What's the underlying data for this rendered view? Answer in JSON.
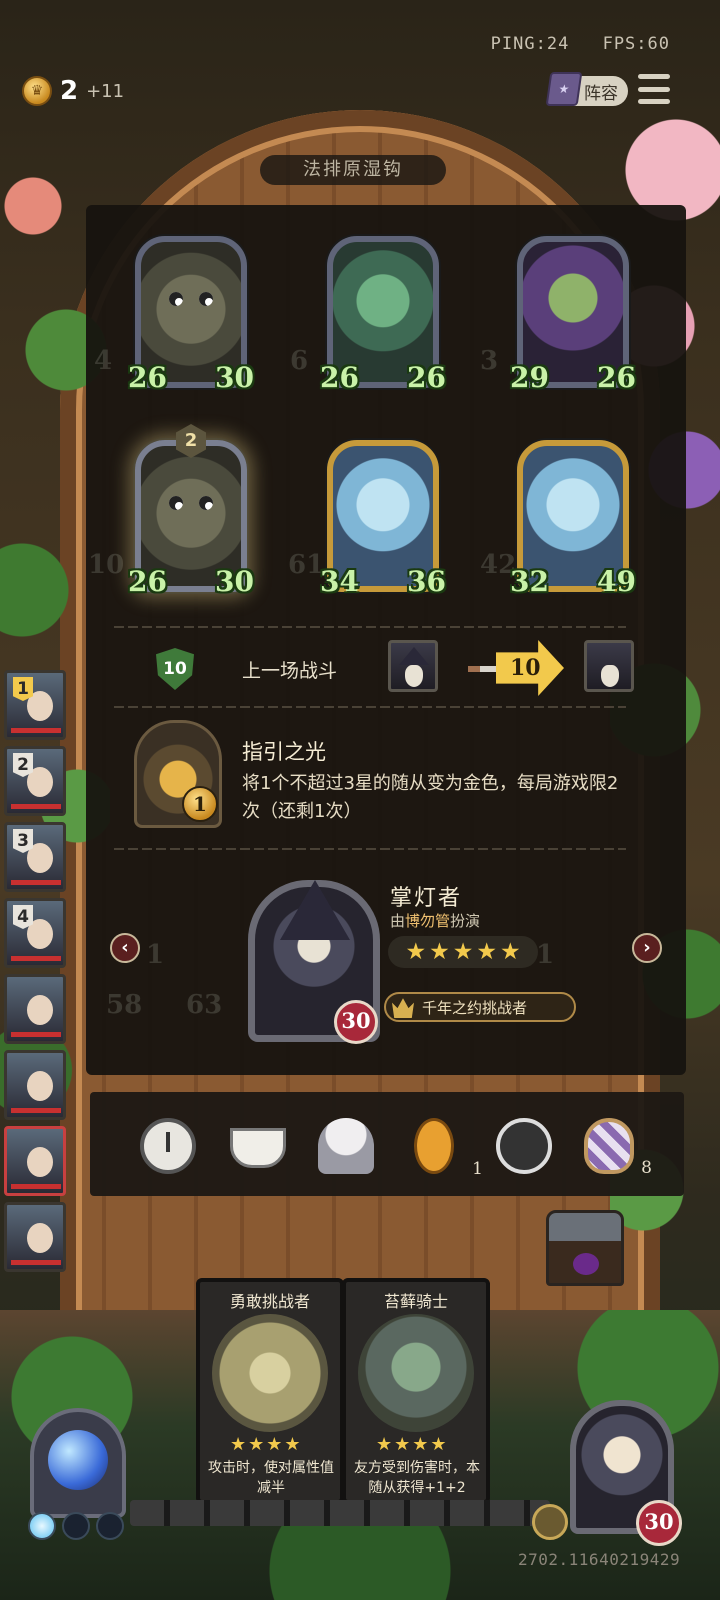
{
  "status": {
    "ping": "PING:24",
    "fps": "FPS:60"
  },
  "gold": {
    "count": "2",
    "income": "+11"
  },
  "header": {
    "lineup_label": "阵容"
  },
  "panel": {
    "title": "法排原湿钩",
    "board": [
      {
        "kind": "golem",
        "atk": "26",
        "hp": "30"
      },
      {
        "kind": "flower",
        "atk": "26",
        "hp": "26"
      },
      {
        "kind": "witch",
        "atk": "29",
        "hp": "26"
      },
      {
        "kind": "golem",
        "atk": "26",
        "hp": "30",
        "level": "2"
      },
      {
        "kind": "gold",
        "atk": "34",
        "hp": "36"
      },
      {
        "kind": "gold",
        "atk": "32",
        "hp": "49"
      }
    ],
    "last_battle": {
      "shield_value": "10",
      "label": "上一场战斗",
      "damage": "10"
    },
    "hero_power": {
      "name": "指引之光",
      "cost": "1",
      "description": "将1个不超过3星的随从变为金色，每局游戏限2次（还剩1次）"
    },
    "hero": {
      "name": "掌灯者",
      "by_prefix": "由",
      "actor": "博勿管",
      "by_suffix": "扮演",
      "stars": 5,
      "title": "千年之约挑战者",
      "hp": "30"
    }
  },
  "players": [
    {
      "rank": "1",
      "active": false
    },
    {
      "rank": "2",
      "active": false
    },
    {
      "rank": "3",
      "active": false
    },
    {
      "rank": "4",
      "active": false
    },
    {
      "rank": "",
      "active": false
    },
    {
      "rank": "",
      "active": false
    },
    {
      "rank": "",
      "active": true
    },
    {
      "rank": "",
      "active": false
    }
  ],
  "items": [
    {
      "icon": "alarm-clock-icon",
      "count": ""
    },
    {
      "icon": "teacup-icon",
      "count": ""
    },
    {
      "icon": "cupcake-icon",
      "count": ""
    },
    {
      "icon": "chicken-icon",
      "count": "1"
    },
    {
      "icon": "bomb-icon",
      "count": ""
    },
    {
      "icon": "striped-shield-icon",
      "count": "8"
    }
  ],
  "shop": [
    {
      "name": "勇敢挑战者",
      "stars": 4,
      "desc": "攻击时，使对属性值减半"
    },
    {
      "name": "苔藓骑士",
      "stars": 4,
      "desc": "友方受到伤害时，本随从获得+1+2"
    }
  ],
  "me": {
    "hp": "30"
  },
  "game_id": "2702.11640219429",
  "colors": {
    "gold": "#f2c94c",
    "stat_green": "#c9f2a8",
    "active_red": "#c84040"
  }
}
